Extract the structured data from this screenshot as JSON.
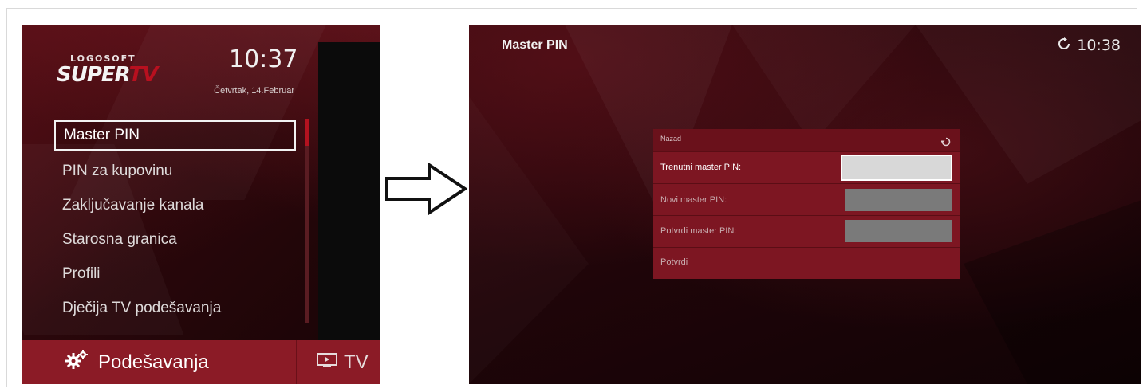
{
  "left_screen": {
    "logo": {
      "top": "LOGOSOFT",
      "main_a": "SUPER",
      "main_b": "TV"
    },
    "time": "10:37",
    "date": "Četvrtak, 14.Februar",
    "menu": [
      {
        "label": "Master PIN",
        "selected": true
      },
      {
        "label": "PIN za kupovinu",
        "selected": false
      },
      {
        "label": "Zaključavanje kanala",
        "selected": false
      },
      {
        "label": "Starosna granica",
        "selected": false
      },
      {
        "label": "Profili",
        "selected": false
      },
      {
        "label": "Dječija TV podešavanja",
        "selected": false
      }
    ],
    "bottom": {
      "settings_label": "Podešavanja",
      "tv_label": "TV"
    }
  },
  "right_screen": {
    "title": "Master PIN",
    "clock": "10:38",
    "dialog": {
      "back_label": "Nazad",
      "rows": [
        {
          "label": "Trenutni master PIN:",
          "active": true
        },
        {
          "label": "Novi master PIN:",
          "active": false
        },
        {
          "label": "Potvrdi master PIN:",
          "active": false
        }
      ],
      "confirm_label": "Potvrdi"
    }
  },
  "icons": {
    "arrow": "right-arrow-icon",
    "settings": "gear-icon",
    "tv": "tv-icon",
    "clock": "clock-icon",
    "back": "back-icon"
  },
  "colors": {
    "accent_red": "#8b1b26",
    "dialog_red": "#7d1622",
    "scroll_thumb": "#b3121f"
  }
}
